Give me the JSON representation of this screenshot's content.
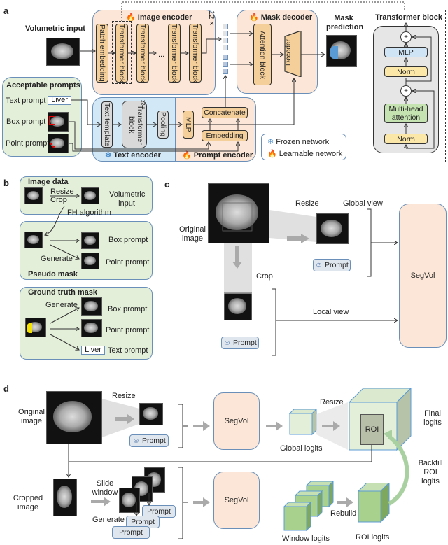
{
  "panel_a": {
    "letter": "a",
    "volumetric_input": "Volumetric input",
    "image_encoder": {
      "title": "Image encoder",
      "repeat": "12 ×",
      "blocks": [
        "Patch embedding",
        "Transformer block",
        "Transformer block",
        "Transformer block",
        "Transformer block"
      ],
      "ellipsis": "..."
    },
    "mask_decoder": {
      "title": "Mask decoder",
      "attention": "Attention block",
      "decoder": "Decoder"
    },
    "mask_prediction": "Mask prediction",
    "acceptable_prompts": {
      "title": "Acceptable prompts",
      "text_prompt": "Text prompt",
      "text_value": "Liver",
      "box_prompt": "Box prompt",
      "point_prompt": "Point prompt"
    },
    "text_encoder": {
      "title": "Text encoder",
      "template": "Text template",
      "transformer": "Transformer block",
      "repeat": "12 ×",
      "pooling": "Pooling"
    },
    "prompt_encoder": {
      "title": "Prompt encoder",
      "mlp": "MLP",
      "concatenate": "Concatenate",
      "embedding": "Embedding"
    },
    "legend": {
      "frozen": "Frozen network",
      "learnable": "Learnable network"
    },
    "transformer_block": {
      "title": "Transformer block",
      "mlp": "MLP",
      "norm1": "Norm",
      "attention": "Multi-head attention",
      "norm2": "Norm",
      "plus": "+"
    }
  },
  "panel_b": {
    "letter": "b",
    "image_data": {
      "title": "Image data",
      "resize": "Resize",
      "crop": "Crop",
      "volumetric_input": "Volumetric input",
      "fh": "FH algorithm"
    },
    "pseudo_mask": {
      "title": "Pseudo mask",
      "generate": "Generate",
      "box_prompt": "Box prompt",
      "point_prompt": "Point prompt"
    },
    "ground_truth": {
      "title": "Ground truth mask",
      "generate": "Generate",
      "box_prompt": "Box prompt",
      "point_prompt": "Point prompt",
      "text_value": "Liver",
      "text_prompt": "Text prompt"
    }
  },
  "panel_c": {
    "letter": "c",
    "original_image": "Original image",
    "resize": "Resize",
    "global_view": "Global view",
    "prompt": "Prompt",
    "crop": "Crop",
    "local_view": "Local view",
    "segvol": "SegVol"
  },
  "panel_d": {
    "letter": "d",
    "original_image": "Original image",
    "resize": "Resize",
    "prompt": "Prompt",
    "segvol": "SegVol",
    "resize2": "Resize",
    "global_logits": "Global logits",
    "roi": "ROI",
    "final_logits": "Final logits",
    "backfill": "Backfill ROI logits",
    "cropped_image": "Cropped image",
    "slide_window": "Slide window",
    "generate": "Generate",
    "prompts": [
      "Prompt",
      "Prompt",
      "Prompt"
    ],
    "segvol2": "SegVol",
    "rebuild": "Rebuild",
    "window_logits": "Window logits",
    "roi_logits": "ROI logits"
  },
  "colors": {
    "peach": "#fbe6d7",
    "green": "#e3efd9",
    "blue": "#d3e8f6",
    "block": "#f5cf9a",
    "border": "#6a8fb8",
    "logits_green": "#a9d18e"
  }
}
